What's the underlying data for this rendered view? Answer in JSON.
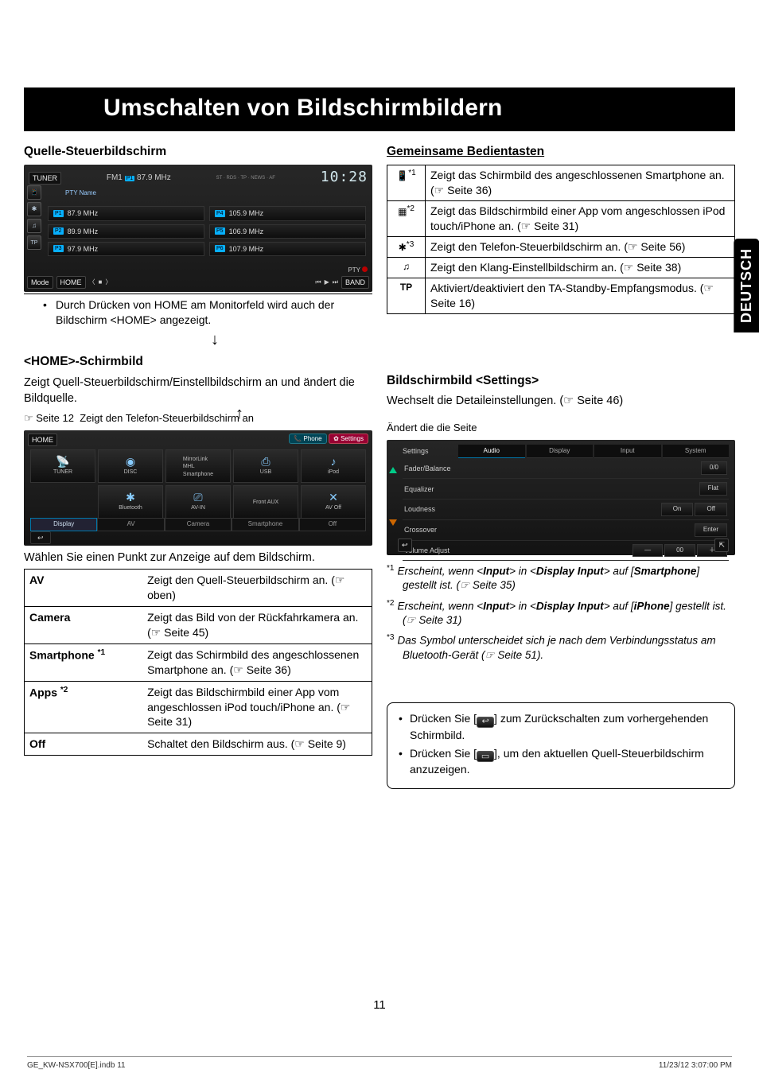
{
  "domain": "Document",
  "page_number": "11",
  "side_tab": "DEUTSCH",
  "title": "Umschalten von Bildschirmbildern",
  "source_control": {
    "heading": "Quelle-Steuerbildschirm",
    "tuner_label": "TUNER",
    "band": "FM1",
    "preset_current_ch": "P1",
    "preset_current": "87.9 MHz",
    "indicators": "ST · RDS · TP · NEWS · AF",
    "time": "10:28",
    "pty": "PTY Name",
    "presets": [
      {
        "ch": "P1",
        "freq": "87.9 MHz"
      },
      {
        "ch": "P4",
        "freq": "105.9 MHz"
      },
      {
        "ch": "P2",
        "freq": "89.9 MHz"
      },
      {
        "ch": "P5",
        "freq": "106.9 MHz"
      },
      {
        "ch": "P3",
        "freq": "97.9 MHz"
      },
      {
        "ch": "P6",
        "freq": "107.9 MHz"
      }
    ],
    "mode_label": "Mode",
    "pty_indicator": "PTY",
    "home_btn": "HOME",
    "band_btn": "BAND",
    "note": "Durch Drücken von HOME am Monitorfeld wird auch der Bildschirm <HOME> angezeigt.",
    "note_bold": "HOME"
  },
  "shared_ops": {
    "heading": "Gemeinsame Bedientasten",
    "rows": [
      {
        "icon": "smartphone-icon",
        "mark": "*1",
        "text": "Zeigt das Schirmbild des angeschlossenen Smartphone an. (☞ Seite 36)"
      },
      {
        "icon": "apps-icon",
        "mark": "*2",
        "text": "Zeigt das Bildschirmbild einer App vom angeschlossen iPod touch/iPhone an. (☞ Seite 31)"
      },
      {
        "icon": "bluetooth-icon",
        "mark": "*3",
        "text": "Zeigt den Telefon-Steuerbildschirm an. (☞ Seite 56)"
      },
      {
        "icon": "equalizer-icon",
        "mark": "",
        "text": "Zeigt den Klang-Einstellbildschirm an. (☞ Seite 38)"
      },
      {
        "icon": "tp-label",
        "mark": "",
        "label": "TP",
        "text": "Aktiviert/deaktiviert den TA-Standby-Empfangsmodus. (☞ Seite 16)"
      }
    ]
  },
  "home_screen": {
    "heading": "<HOME>-Schirmbild",
    "desc": "Zeigt Quell-Steuerbildschirm/Einstellbildschirm an und ändert die Bildquelle.",
    "ref": "☞ Seite 12",
    "telco_caption": "Zeigt den Telefon-Steuerbildschirm an",
    "header_label": "HOME",
    "phone_pill": "Phone",
    "settings_pill": "Settings",
    "sources": [
      {
        "label": "TUNER",
        "icon": "📡"
      },
      {
        "label": "DISC",
        "icon": "◉"
      },
      {
        "label": "MirrorLink · MHL · Smartphone",
        "icon": ""
      },
      {
        "label": "USB",
        "icon": "⎙"
      },
      {
        "label": "iPod",
        "icon": "♪"
      },
      {
        "label": "Bluetooth",
        "icon": "✱"
      },
      {
        "label": "AV-IN",
        "icon": "⎚"
      },
      {
        "label": "Front AUX",
        "icon": ""
      },
      {
        "label": "AV Off",
        "icon": "✕"
      }
    ],
    "tabs": [
      "Display",
      "AV",
      "Camera",
      "Smartphone",
      "Off"
    ],
    "select_prompt": "Wählen Sie einen Punkt zur Anzeige auf dem Bildschirm.",
    "table": [
      {
        "key": "AV",
        "val": "Zeigt den Quell-Steuerbildschirm an. (☞ oben)"
      },
      {
        "key": "Camera",
        "val": "Zeigt das Bild von der Rückfahrkamera an. (☞ Seite 45)"
      },
      {
        "key": "Smartphone",
        "sup": "*1",
        "val": "Zeigt das Schirmbild des angeschlossenen Smartphone an. (☞ Seite 36)"
      },
      {
        "key": "Apps",
        "sup": "*2",
        "val": "Zeigt das Bildschirmbild einer App vom angeschlossen iPod touch/iPhone an. (☞ Seite 31)"
      },
      {
        "key": "Off",
        "val": "Schaltet den Bildschirm aus. (☞ Seite 9)"
      }
    ]
  },
  "settings_screen": {
    "heading": "Bildschirmbild <Settings>",
    "desc": "Wechselt die Detaileinstellungen. (☞ Seite 46)",
    "pager_label": "Ändert die die Seite",
    "title_in_shot": "Settings",
    "tabs": [
      "Audio",
      "Display",
      "Input",
      "System"
    ],
    "rows": [
      {
        "name": "Fader/Balance",
        "val": "0/0"
      },
      {
        "name": "Equalizer",
        "val": "Flat"
      },
      {
        "name": "Loudness",
        "val_on": "On",
        "val_off": "Off"
      },
      {
        "name": "Crossover",
        "val": "Enter"
      },
      {
        "name": "Volume Adjust",
        "val": "00",
        "stepper": true
      }
    ]
  },
  "footnotes": [
    {
      "mark": "*1",
      "text": "Erscheint, wenn <Input> in <Display Input> auf [Smartphone] gestellt ist. (☞ Seite 35)",
      "bold": [
        "Input",
        "Display Input",
        "Smartphone"
      ]
    },
    {
      "mark": "*2",
      "text": "Erscheint, wenn <Input> in <Display Input> auf [iPhone] gestellt ist. (☞ Seite 31)",
      "bold": [
        "Input",
        "Display Input",
        "iPhone"
      ]
    },
    {
      "mark": "*3",
      "text": "Das Symbol unterscheidet sich je nach dem Verbindungsstatus am Bluetooth-Gerät (☞ Seite 51)."
    }
  ],
  "tip_box": {
    "items": [
      {
        "pre": "Drücken Sie [",
        "icon": "back-icon",
        "glyph": "↩",
        "post": "] zum Zurückschalten zum vorhergehenden Schirmbild."
      },
      {
        "pre": "Drücken Sie [",
        "icon": "current-source-icon",
        "glyph": "",
        "post": "], um den aktuellen Quell-Steuerbildschirm anzuzeigen."
      }
    ]
  },
  "footer": {
    "left": "GE_KW-NSX700[E].indb   11",
    "right": "11/23/12   3:07:00 PM"
  }
}
